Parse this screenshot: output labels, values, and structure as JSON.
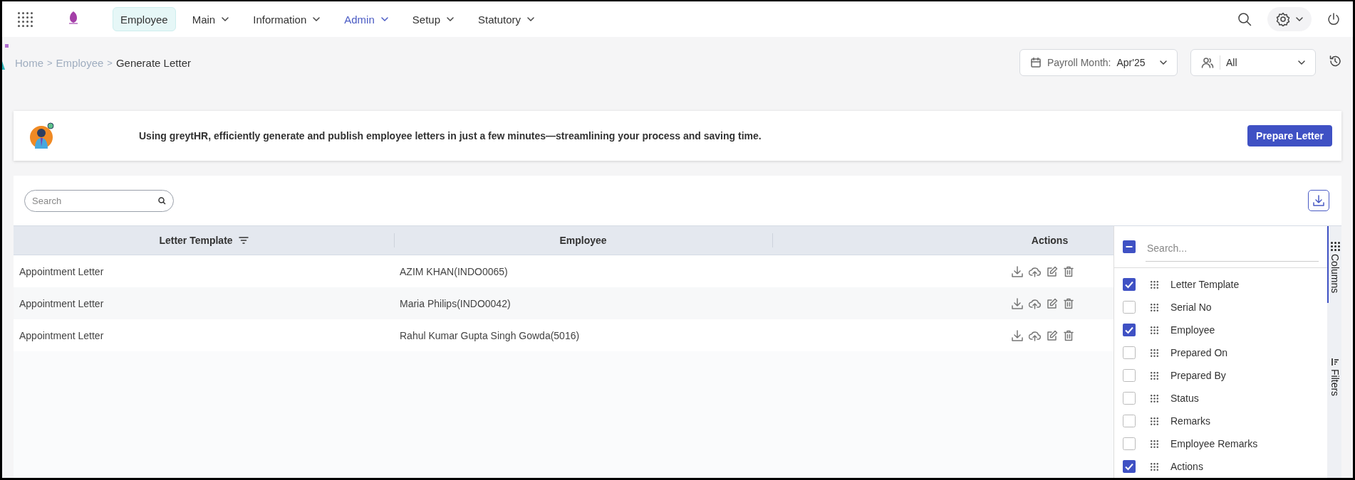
{
  "nav": {
    "items": [
      {
        "label": "Employee",
        "selected": true,
        "hover": false,
        "has_menu": false
      },
      {
        "label": "Main",
        "selected": false,
        "hover": false,
        "has_menu": true
      },
      {
        "label": "Information",
        "selected": false,
        "hover": false,
        "has_menu": true
      },
      {
        "label": "Admin",
        "selected": false,
        "hover": true,
        "has_menu": true
      },
      {
        "label": "Setup",
        "selected": false,
        "hover": false,
        "has_menu": true
      },
      {
        "label": "Statutory",
        "selected": false,
        "hover": false,
        "has_menu": true
      }
    ]
  },
  "breadcrumb": {
    "separator": ">",
    "items": [
      {
        "label": "Home",
        "kind": "link"
      },
      {
        "label": "Employee",
        "kind": "link"
      },
      {
        "label": "Generate Letter",
        "kind": "current"
      }
    ]
  },
  "payroll_month": {
    "label": "Payroll Month:",
    "value": "Apr'25"
  },
  "employee_filter": {
    "value": "All"
  },
  "banner": {
    "message": "Using greytHR, efficiently generate and publish employee letters in just a few minutes—streamlining your process and saving time.",
    "button": "Prepare Letter"
  },
  "search": {
    "placeholder": "Search"
  },
  "table": {
    "columns": [
      {
        "label": "Letter Template",
        "filterable": true
      },
      {
        "label": "Employee",
        "filterable": false
      },
      {
        "label": "Actions",
        "filterable": false
      }
    ],
    "rows": [
      {
        "cells": [
          "Appointment Letter",
          "AZIM KHAN(INDO0065)"
        ]
      },
      {
        "cells": [
          "Appointment Letter",
          "Maria Philips(INDO0042)"
        ]
      },
      {
        "cells": [
          "Appointment Letter",
          "Rahul Kumar Gupta Singh Gowda(5016)"
        ]
      }
    ]
  },
  "column_panel": {
    "search_placeholder": "Search...",
    "select_all_partial": true,
    "items": [
      {
        "label": "Letter Template",
        "checked": true
      },
      {
        "label": "Serial No",
        "checked": false
      },
      {
        "label": "Employee",
        "checked": true
      },
      {
        "label": "Prepared On",
        "checked": false
      },
      {
        "label": "Prepared By",
        "checked": false
      },
      {
        "label": "Status",
        "checked": false
      },
      {
        "label": "Remarks",
        "checked": false
      },
      {
        "label": "Employee Remarks",
        "checked": false
      },
      {
        "label": "Actions",
        "checked": true
      }
    ]
  },
  "side_tabs": [
    {
      "label": "Columns",
      "kind": "columns",
      "selected": true
    },
    {
      "label": "Filters",
      "kind": "filters",
      "selected": false
    }
  ]
}
